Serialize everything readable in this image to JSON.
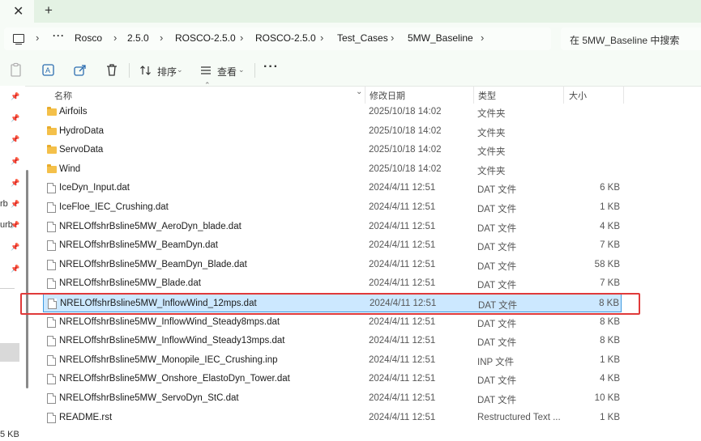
{
  "tabs": {
    "close": "✕",
    "new": "+"
  },
  "breadcrumb": [
    "Rosco",
    "2.5.0",
    "ROSCO-2.5.0",
    "ROSCO-2.5.0",
    "Test_Cases",
    "5MW_Baseline"
  ],
  "addr": {
    "more": "···",
    "sep": "›"
  },
  "search": {
    "placeholder": "在 5MW_Baseline 中搜索"
  },
  "toolbar": {
    "sort": "排序",
    "view": "查看",
    "more": "···"
  },
  "nav": {
    "frag1": "rb",
    "frag2": "urb"
  },
  "headers": {
    "name": "名称",
    "date": "修改日期",
    "type": "类型",
    "size": "大小"
  },
  "files": [
    {
      "name": "Airfoils",
      "date": "2025/10/18 14:02",
      "type": "文件夹",
      "size": "",
      "kind": "folder"
    },
    {
      "name": "HydroData",
      "date": "2025/10/18 14:02",
      "type": "文件夹",
      "size": "",
      "kind": "folder"
    },
    {
      "name": "ServoData",
      "date": "2025/10/18 14:02",
      "type": "文件夹",
      "size": "",
      "kind": "folder"
    },
    {
      "name": "Wind",
      "date": "2025/10/18 14:02",
      "type": "文件夹",
      "size": "",
      "kind": "folder"
    },
    {
      "name": "IceDyn_Input.dat",
      "date": "2024/4/11 12:51",
      "type": "DAT 文件",
      "size": "6 KB",
      "kind": "file"
    },
    {
      "name": "IceFloe_IEC_Crushing.dat",
      "date": "2024/4/11 12:51",
      "type": "DAT 文件",
      "size": "1 KB",
      "kind": "file"
    },
    {
      "name": "NRELOffshrBsline5MW_AeroDyn_blade.dat",
      "date": "2024/4/11 12:51",
      "type": "DAT 文件",
      "size": "4 KB",
      "kind": "file"
    },
    {
      "name": "NRELOffshrBsline5MW_BeamDyn.dat",
      "date": "2024/4/11 12:51",
      "type": "DAT 文件",
      "size": "7 KB",
      "kind": "file"
    },
    {
      "name": "NRELOffshrBsline5MW_BeamDyn_Blade.dat",
      "date": "2024/4/11 12:51",
      "type": "DAT 文件",
      "size": "58 KB",
      "kind": "file"
    },
    {
      "name": "NRELOffshrBsline5MW_Blade.dat",
      "date": "2024/4/11 12:51",
      "type": "DAT 文件",
      "size": "7 KB",
      "kind": "file"
    },
    {
      "name": "NRELOffshrBsline5MW_InflowWind_12mps.dat",
      "date": "2024/4/11 12:51",
      "type": "DAT 文件",
      "size": "8 KB",
      "kind": "file",
      "selected": true
    },
    {
      "name": "NRELOffshrBsline5MW_InflowWind_Steady8mps.dat",
      "date": "2024/4/11 12:51",
      "type": "DAT 文件",
      "size": "8 KB",
      "kind": "file"
    },
    {
      "name": "NRELOffshrBsline5MW_InflowWind_Steady13mps.dat",
      "date": "2024/4/11 12:51",
      "type": "DAT 文件",
      "size": "8 KB",
      "kind": "file"
    },
    {
      "name": "NRELOffshrBsline5MW_Monopile_IEC_Crushing.inp",
      "date": "2024/4/11 12:51",
      "type": "INP 文件",
      "size": "1 KB",
      "kind": "file"
    },
    {
      "name": "NRELOffshrBsline5MW_Onshore_ElastoDyn_Tower.dat",
      "date": "2024/4/11 12:51",
      "type": "DAT 文件",
      "size": "4 KB",
      "kind": "file"
    },
    {
      "name": "NRELOffshrBsline5MW_ServoDyn_StC.dat",
      "date": "2024/4/11 12:51",
      "type": "DAT 文件",
      "size": "10 KB",
      "kind": "file"
    },
    {
      "name": "README.rst",
      "date": "2024/4/11 12:51",
      "type": "Restructured Text ...",
      "size": "1 KB",
      "kind": "file"
    }
  ],
  "status": {
    "size_fragment": "5 KB"
  },
  "colors": {
    "selection": "#cce8ff",
    "highlight": "#e03a3a",
    "folder": "#f4c04a"
  }
}
